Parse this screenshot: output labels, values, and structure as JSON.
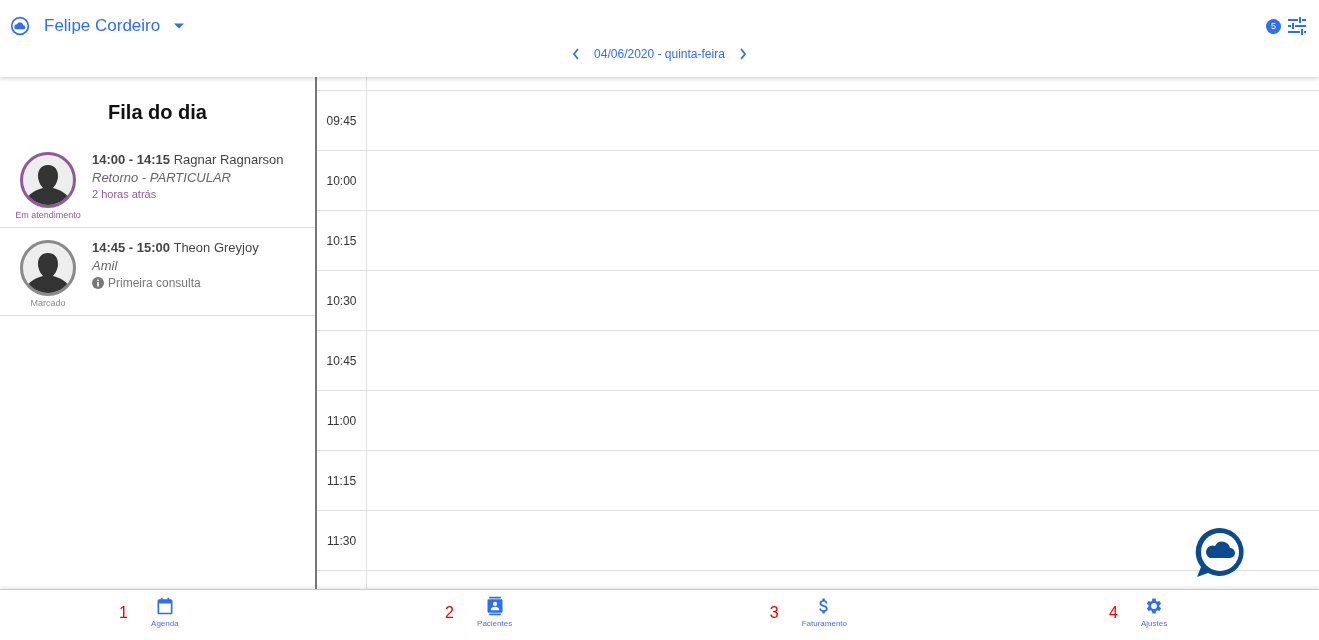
{
  "header": {
    "user": "Felipe Cordeiro",
    "date": "04/06/2020 - quinta-feira",
    "filter_count": "5"
  },
  "queue": {
    "title": "Fila do dia",
    "items": [
      {
        "time": "14:00 - 14:15",
        "name": "Ragnar Ragnarson",
        "subtitle": "Retorno - PARTICULAR",
        "note": "2 horas atrás",
        "kind": "elapsed",
        "status": "Em atendimento",
        "color": "#8e5a97"
      },
      {
        "time": "14:45 - 15:00",
        "name": "Theon Greyjoy",
        "subtitle": "Amil",
        "note": "Primeira consulta",
        "kind": "info",
        "status": "Marcado",
        "color": "#8a8a8a"
      }
    ]
  },
  "schedule": {
    "slots": [
      "09:45",
      "10:00",
      "10:15",
      "10:30",
      "10:45",
      "11:00",
      "11:15",
      "11:30"
    ]
  },
  "nav": [
    {
      "label": "Agenda",
      "kind": "calendar",
      "marker": "1"
    },
    {
      "label": "Pacientes",
      "kind": "contact",
      "marker": "2"
    },
    {
      "label": "Faturamento",
      "kind": "dollar",
      "marker": "3"
    },
    {
      "label": "Ajustes",
      "kind": "gear",
      "marker": "4"
    }
  ]
}
